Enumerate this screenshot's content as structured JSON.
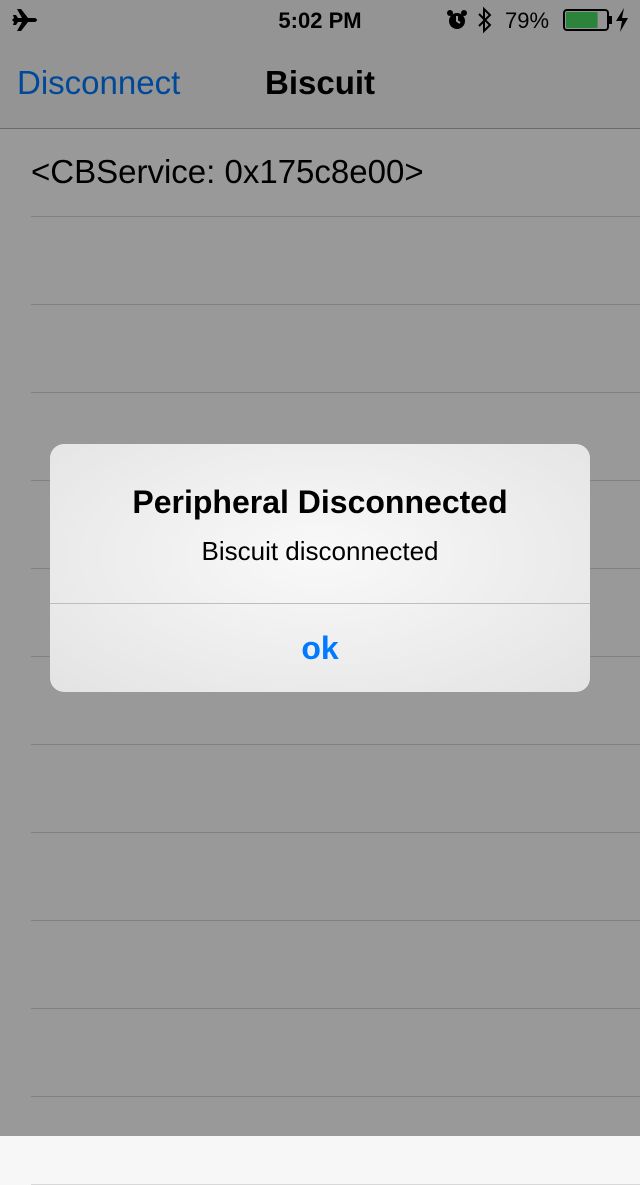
{
  "status_bar": {
    "time": "5:02 PM",
    "battery_percent": "79%",
    "battery_level": 0.79,
    "icons": [
      "airplane-icon",
      "alarm-icon",
      "bluetooth-icon",
      "battery-icon",
      "charging-bolt-icon"
    ]
  },
  "nav": {
    "back_label": "Disconnect",
    "title": "Biscuit"
  },
  "table": {
    "rows": [
      "<CBService: 0x175c8e00>",
      "",
      "",
      "",
      "",
      "",
      "",
      "",
      "",
      "",
      "",
      ""
    ]
  },
  "alert": {
    "title": "Peripheral Disconnected",
    "message": "Biscuit disconnected",
    "button_label": "ok"
  },
  "colors": {
    "accent": "#007aff",
    "battery_fill": "#4cd964",
    "separator": "#d8d8d8"
  }
}
